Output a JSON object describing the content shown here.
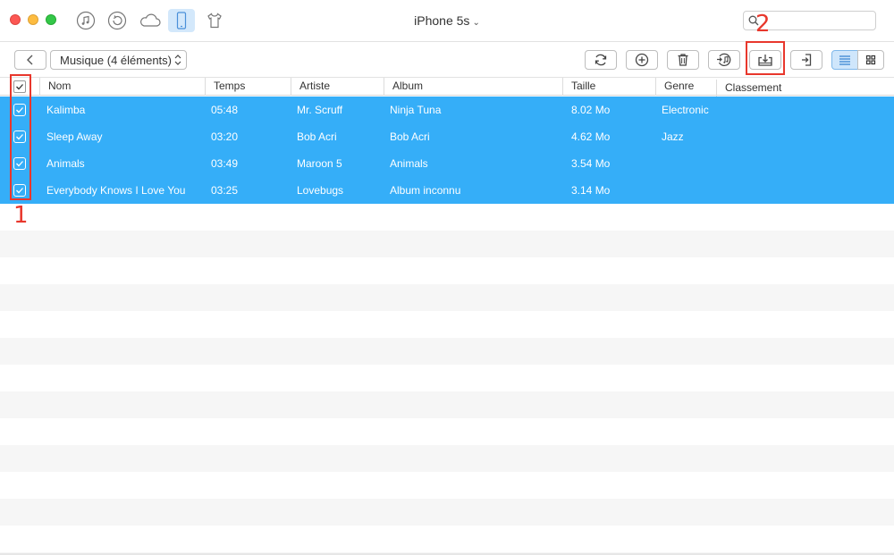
{
  "window": {
    "title": "iPhone 5s",
    "title_chevron": "⌄"
  },
  "top_icons": [
    "music-note-icon",
    "history-icon",
    "cloud-icon",
    "phone-icon",
    "shirt-icon"
  ],
  "search": {
    "placeholder": ""
  },
  "toolbar": {
    "category_label": "Musique (4 éléments)",
    "actions": [
      "refresh-icon",
      "add-icon",
      "trash-icon",
      "to-itunes-icon",
      "export-to-computer-icon",
      "import-to-device-icon"
    ],
    "view": "list"
  },
  "table": {
    "headers": [
      "Nom",
      "Temps",
      "Artiste",
      "Album",
      "Taille",
      "Genre",
      "Classement"
    ],
    "rows": [
      {
        "nom": "Kalimba",
        "temps": "05:48",
        "artiste": "Mr. Scruff",
        "album": "Ninja Tuna",
        "taille": "8.02 Mo",
        "genre": "Electronic"
      },
      {
        "nom": "Sleep Away",
        "temps": "03:20",
        "artiste": "Bob Acri",
        "album": "Bob Acri",
        "taille": "4.62 Mo",
        "genre": "Jazz"
      },
      {
        "nom": "Animals",
        "temps": "03:49",
        "artiste": "Maroon 5",
        "album": "Animals",
        "taille": "3.54 Mo",
        "genre": ""
      },
      {
        "nom": "Everybody Knows I Love You",
        "temps": "03:25",
        "artiste": "Lovebugs",
        "album": "Album inconnu",
        "taille": "3.14 Mo",
        "genre": ""
      }
    ]
  },
  "annotations": {
    "one": "1",
    "two": "2"
  },
  "colors": {
    "selection": "#35aef8",
    "annotation": "#e8372c",
    "stripe": "#f6f6f6"
  }
}
